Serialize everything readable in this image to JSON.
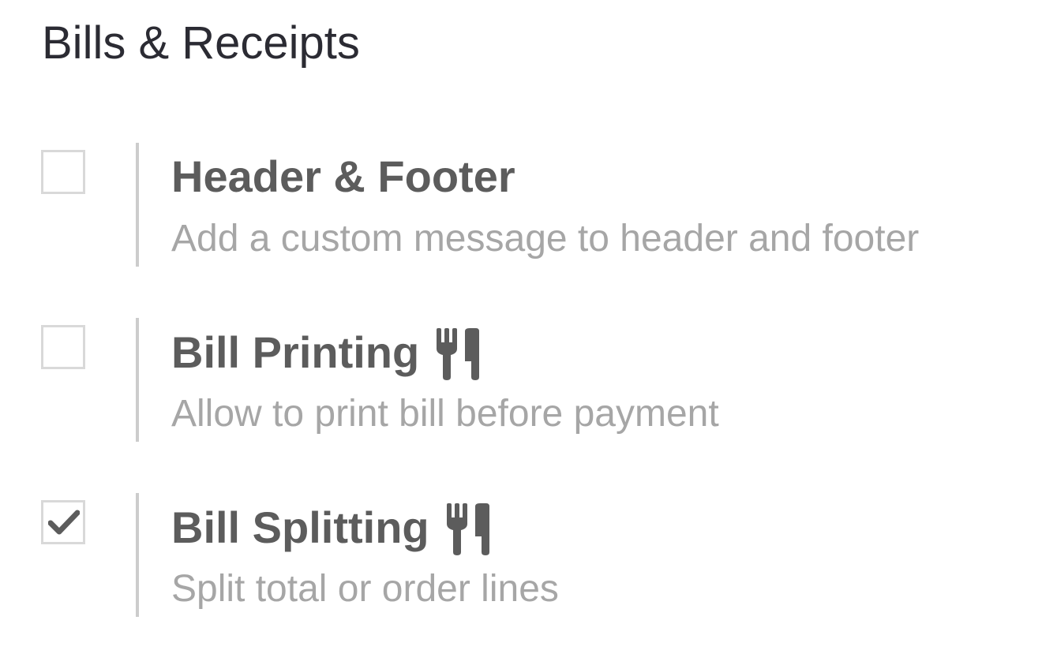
{
  "section": {
    "title": "Bills & Receipts"
  },
  "settings": [
    {
      "title": "Header & Footer",
      "description": "Add a custom message to header and footer",
      "checked": false,
      "icon": null
    },
    {
      "title": "Bill Printing",
      "description": "Allow to print bill before payment",
      "checked": false,
      "icon": "cutlery-icon"
    },
    {
      "title": "Bill Splitting",
      "description": "Split total or order lines",
      "checked": true,
      "icon": "cutlery-icon"
    }
  ],
  "colors": {
    "title": "#2b2b33",
    "setting_title": "#5c5c5c",
    "description": "#a6a6a6",
    "divider": "#cccccc",
    "checkbox_border": "#d9d9d9",
    "checkmark": "#5c5c5c"
  }
}
